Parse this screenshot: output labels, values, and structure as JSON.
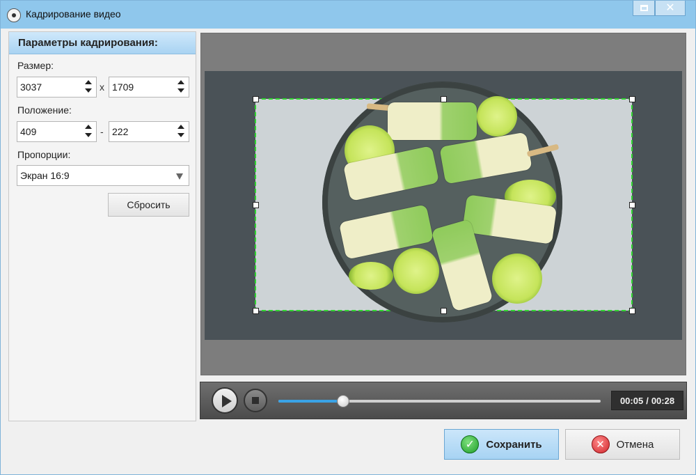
{
  "window": {
    "title": "Кадрирование видео"
  },
  "panel": {
    "header": "Параметры кадрирования:",
    "size_label": "Размер:",
    "width_value": "3037",
    "size_separator": "x",
    "height_value": "1709",
    "position_label": "Положение:",
    "pos_x_value": "409",
    "position_separator": "-",
    "pos_y_value": "222",
    "ratio_label": "Пропорции:",
    "ratio_selected": "Экран 16:9",
    "reset_label": "Сбросить"
  },
  "player": {
    "current_time": "00:05",
    "time_separator": "/",
    "total_time": "00:28",
    "progress_fraction": 0.2,
    "accent_color": "#3aa3e6"
  },
  "preview": {
    "crop_border_color": "#2fd62f"
  },
  "actions": {
    "save_label": "Сохранить",
    "cancel_label": "Отмена"
  },
  "icons": {
    "app": "film-reel-icon",
    "maximize": "maximize-icon",
    "close": "close-icon",
    "play": "play-icon",
    "stop": "stop-icon",
    "save": "checkmark-icon",
    "cancel": "cancel-x-icon"
  }
}
